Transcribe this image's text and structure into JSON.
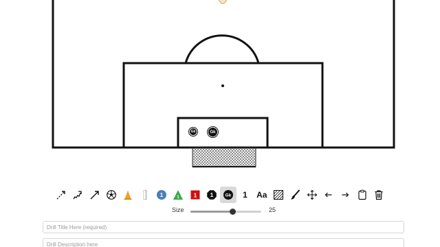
{
  "players": {
    "gk1_label": "Gk",
    "gk2_label": "Gk"
  },
  "toolbar": {
    "tools": [
      {
        "name": "dashed-arrow-tool"
      },
      {
        "name": "squiggle-arrow-tool"
      },
      {
        "name": "arrow-tool"
      },
      {
        "name": "ball-tool"
      },
      {
        "name": "cone-tool"
      },
      {
        "name": "pole-tool"
      },
      {
        "name": "blue-player-tool",
        "label": "1"
      },
      {
        "name": "green-player-tool",
        "label": "1"
      },
      {
        "name": "red-player-tool",
        "label": "1"
      },
      {
        "name": "black-player-tool",
        "label": "1"
      },
      {
        "name": "goalkeeper-tool",
        "label": "Gk",
        "selected": true
      },
      {
        "name": "number-tool",
        "label": "1"
      },
      {
        "name": "text-tool",
        "label": "Aa"
      },
      {
        "name": "hatch-area-tool"
      },
      {
        "name": "brush-tool"
      },
      {
        "name": "move-tool"
      },
      {
        "name": "undo-tool"
      },
      {
        "name": "redo-tool"
      },
      {
        "name": "clipboard-tool"
      },
      {
        "name": "delete-tool"
      }
    ]
  },
  "size_control": {
    "label": "Size",
    "value": "25",
    "fraction": 0.6
  },
  "form": {
    "title_placeholder": "Drill Title Here (required)",
    "description_placeholder": "Drill Description here"
  },
  "colors": {
    "line": "#111111",
    "blue_player": "#4a7fb5",
    "green_player": "#3aa84a",
    "red_player": "#cc1111",
    "cone": "#f0a020",
    "selected_bg": "#d9d9d9"
  }
}
